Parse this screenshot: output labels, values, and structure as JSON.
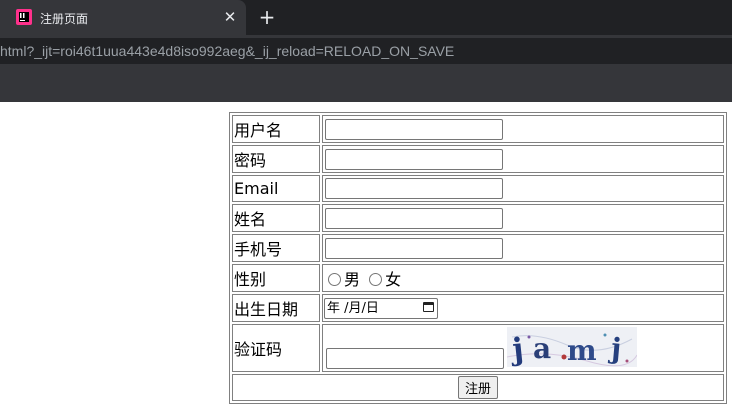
{
  "browser": {
    "tab_title": "注册页面",
    "close_glyph": "✕",
    "new_tab_glyph": "+",
    "url": "html?_ijt=roi46t1uua443e4d8iso992aeg&_ij_reload=RELOAD_ON_SAVE"
  },
  "form": {
    "fields": [
      {
        "label": "用户名",
        "value": ""
      },
      {
        "label": "密码",
        "value": ""
      },
      {
        "label": "Email",
        "value": ""
      },
      {
        "label": "姓名",
        "value": ""
      },
      {
        "label": "手机号",
        "value": ""
      }
    ],
    "gender": {
      "label": "性别",
      "options": [
        "男",
        "女"
      ]
    },
    "birthday": {
      "label": "出生日期",
      "placeholder": "年 /月/日"
    },
    "captcha": {
      "label": "验证码",
      "value": "",
      "image_text": "jamj"
    },
    "submit_label": "注册"
  }
}
